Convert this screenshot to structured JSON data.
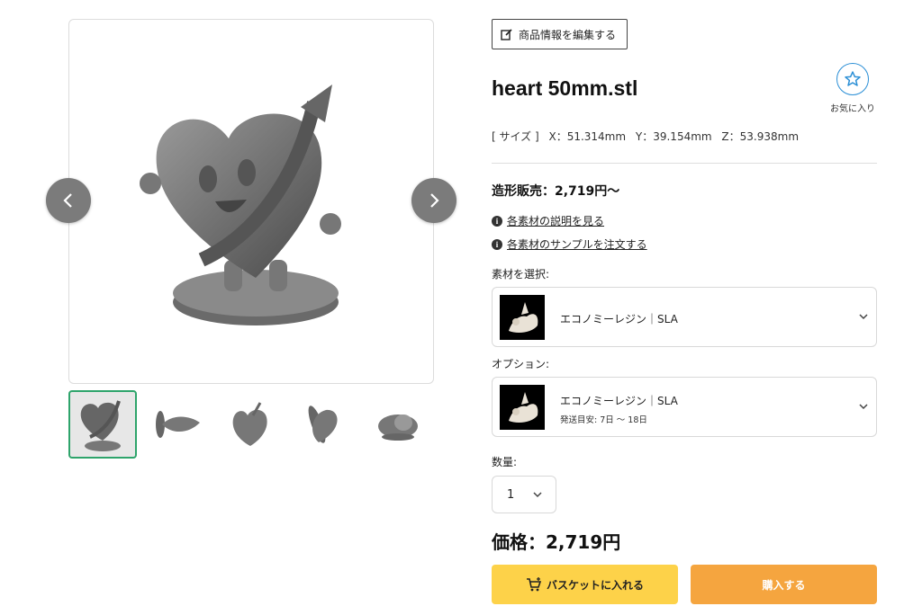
{
  "gallery": {
    "main_image_icon": "heart-character-model-icon",
    "prev_icon": "chevron-left-icon",
    "next_icon": "chevron-right-icon",
    "thumbnails": [
      {
        "icon": "heart-front-view-icon",
        "active": true
      },
      {
        "icon": "heart-top-view-icon",
        "active": false
      },
      {
        "icon": "heart-bottom-view-icon",
        "active": false
      },
      {
        "icon": "heart-side-view-icon",
        "active": false
      },
      {
        "icon": "heart-back-view-icon",
        "active": false
      }
    ]
  },
  "product": {
    "edit_label": "商品情報を編集する",
    "title": "heart 50mm.stl",
    "favorite_label": "お気に入り",
    "size_prefix": "[ サイズ ]",
    "size_x": "X：51.314mm",
    "size_y": "Y：39.154mm",
    "size_z": "Z：53.938mm",
    "from_price": "造形販売：2,719円〜",
    "link_explain": "各素材の説明を見る",
    "link_samples": "各素材のサンプルを注文する"
  },
  "material": {
    "label": "素材を選択:",
    "selected": "エコノミーレジン｜SLA"
  },
  "option": {
    "label": "オプション:",
    "selected": "エコノミーレジン｜SLA",
    "shipping": "発送目安: 7日 〜 18日"
  },
  "quantity": {
    "label": "数量:",
    "value": "1"
  },
  "price": "価格：2,719円",
  "buttons": {
    "basket": "バスケットに入れる",
    "buy": "購入する"
  },
  "colors": {
    "accent_green": "#2ea46b",
    "favorite_blue": "#2b8fd6",
    "basket_yellow": "#fdd249",
    "buy_orange": "#f5a53f"
  }
}
